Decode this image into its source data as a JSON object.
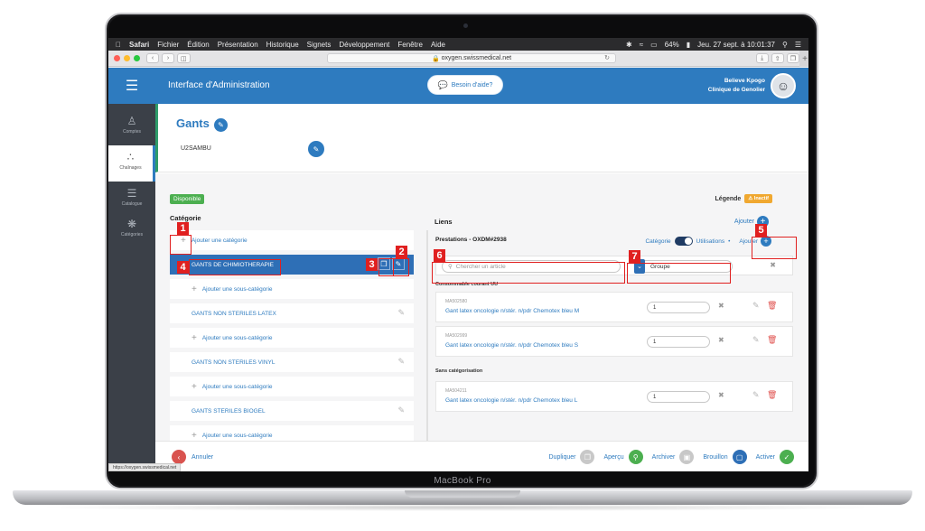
{
  "device": {
    "label": "MacBook Pro"
  },
  "menubar": {
    "apple": "",
    "items": [
      "Safari",
      "Fichier",
      "Édition",
      "Présentation",
      "Historique",
      "Signets",
      "Développement",
      "Fenêtre",
      "Aide"
    ],
    "battery": "64%",
    "datetime": "Jeu. 27 sept. à 10:01:37"
  },
  "browser": {
    "url": "oxygen.swissmedical.net",
    "status_url": "https://oxygen.swissmedical.net"
  },
  "header": {
    "title": "Interface d'Administration",
    "help_label": "Besoin d'aide?",
    "user_name": "Believe Kpogo",
    "user_org": "Clinique de Genolier"
  },
  "sidebar": {
    "items": [
      {
        "label": "Comptes",
        "icon": "users-icon"
      },
      {
        "label": "Chaînages",
        "icon": "tree-icon"
      },
      {
        "label": "Catalogue",
        "icon": "list-icon"
      },
      {
        "label": "Catégories",
        "icon": "network-icon"
      }
    ]
  },
  "product": {
    "title": "Gants",
    "code": "U2SAMBU"
  },
  "status": {
    "disponible": "Disponible",
    "legende": "Légende",
    "inactif": "Inactif"
  },
  "categories": {
    "title": "Catégorie",
    "add_category": "Ajouter une catégorie",
    "add_subcategory": "Ajouter une sous-catégorie",
    "items": [
      "GANTS DE CHIMIOTHERAPIE",
      "GANTS NON STERILES LATEX",
      "GANTS NON STERILES VINYL",
      "GANTS STERILES BIOGEL"
    ]
  },
  "links": {
    "title": "Liens",
    "add_label": "Ajouter",
    "prestation_title": "Prestations - OXDM#2938",
    "toggle_left": "Catégorie",
    "toggle_right": "Utilisations",
    "search_placeholder": "Chercher un article",
    "group_value": "Groupe",
    "sections": [
      {
        "label": "Consommable courant UU",
        "items": [
          {
            "code": "MA502580",
            "name": "Gant latex oncologie n/stér. n/pdr Chemotex bleu M",
            "qty": "1"
          },
          {
            "code": "MA502999",
            "name": "Gant latex oncologie n/stér. n/pdr Chemotex bleu S",
            "qty": "1"
          }
        ]
      },
      {
        "label": "Sans catégorisation",
        "items": [
          {
            "code": "MA504211",
            "name": "Gant latex oncologie n/stér. n/pdr Chemotex bleu L",
            "qty": "1"
          }
        ]
      }
    ]
  },
  "footer": {
    "cancel": "Annuler",
    "actions": [
      "Dupliquer",
      "Aperçu",
      "Archiver",
      "Brouillon",
      "Activer"
    ]
  },
  "annotations": [
    "1",
    "2",
    "3",
    "4",
    "5",
    "6",
    "7"
  ],
  "colors": {
    "primary": "#2e7bbf",
    "sidebar": "#3b4048",
    "success": "#4caf50",
    "warning": "#f0a830",
    "annotation": "#e02020"
  }
}
